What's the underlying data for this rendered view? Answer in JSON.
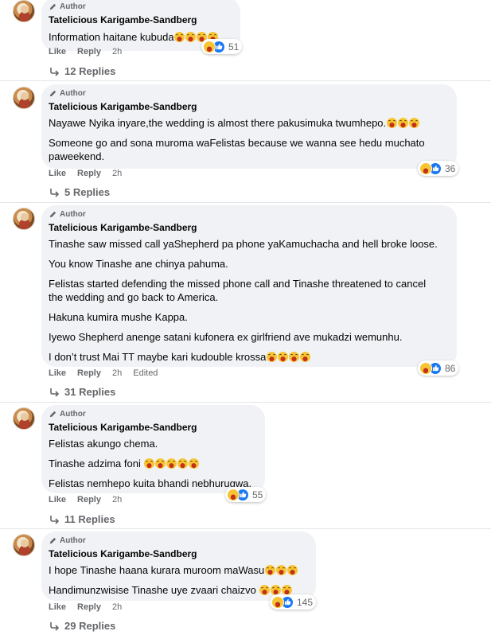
{
  "author_badge": "Author",
  "like_label": "Like",
  "reply_label": "Reply",
  "comments": [
    {
      "name": "Tatelicious Karigambe-Sandberg",
      "paragraphs": [
        {
          "text": "Information haitane kubuda",
          "emoji": 4
        }
      ],
      "reaction_count": "51",
      "time": "2h",
      "edited": "",
      "replies": "12 Replies"
    },
    {
      "name": "Tatelicious Karigambe-Sandberg",
      "paragraphs": [
        {
          "text": "Nayawe Nyika inyare,the wedding is almost there pakusimuka twumhepo.",
          "emoji": 3
        },
        {
          "text": "Someone go and sona muroma waFelistas because we wanna see hedu muchato",
          "emoji": 0
        },
        {
          "text": "paweekend.",
          "emoji": 0
        }
      ],
      "reaction_count": "36",
      "time": "2h",
      "edited": "",
      "replies": "5 Replies"
    },
    {
      "name": "Tatelicious Karigambe-Sandberg",
      "paragraphs": [
        {
          "text": "Tinashe saw missed call yaShepherd pa phone yaKamuchacha and hell broke loose.",
          "emoji": 0
        },
        {
          "text": "You know Tinashe ane chinya pahuma.",
          "emoji": 0
        },
        {
          "text": "Felistas started defending the missed phone call and Tinashe threatened to cancel",
          "emoji": 0
        },
        {
          "text": "the wedding and go back to America.",
          "emoji": 0
        },
        {
          "text": "Hakuna kumira mushe Kappa.",
          "emoji": 0
        },
        {
          "text": "Iyewo Shepherd anenge satani kufonera ex girlfriend ave mukadzi wemunhu.",
          "emoji": 0
        },
        {
          "text": "I don’t trust Mai TT maybe kari kudouble krossa",
          "emoji": 4
        }
      ],
      "reaction_count": "86",
      "time": "2h",
      "edited": "Edited",
      "replies": "31 Replies"
    },
    {
      "name": "Tatelicious Karigambe-Sandberg",
      "paragraphs": [
        {
          "text": "Felistas akungo chema.",
          "emoji": 0
        },
        {
          "text": "Tinashe adzima foni ",
          "emoji": 5
        },
        {
          "text": "Felistas nemhepo kuita bhandi nebhurugwa.",
          "emoji": 0
        }
      ],
      "reaction_count": "55",
      "time": "2h",
      "edited": "",
      "replies": "11 Replies"
    },
    {
      "name": "Tatelicious Karigambe-Sandberg",
      "paragraphs": [
        {
          "text": "I hope Tinashe haana kurara muroom maWasu",
          "emoji": 3
        },
        {
          "text": "Handimunzwisise Tinashe uye zvaari chaizvo ",
          "emoji": 3
        }
      ],
      "reaction_count": "145",
      "time": "2h",
      "edited": "",
      "replies": "29 Replies"
    }
  ]
}
